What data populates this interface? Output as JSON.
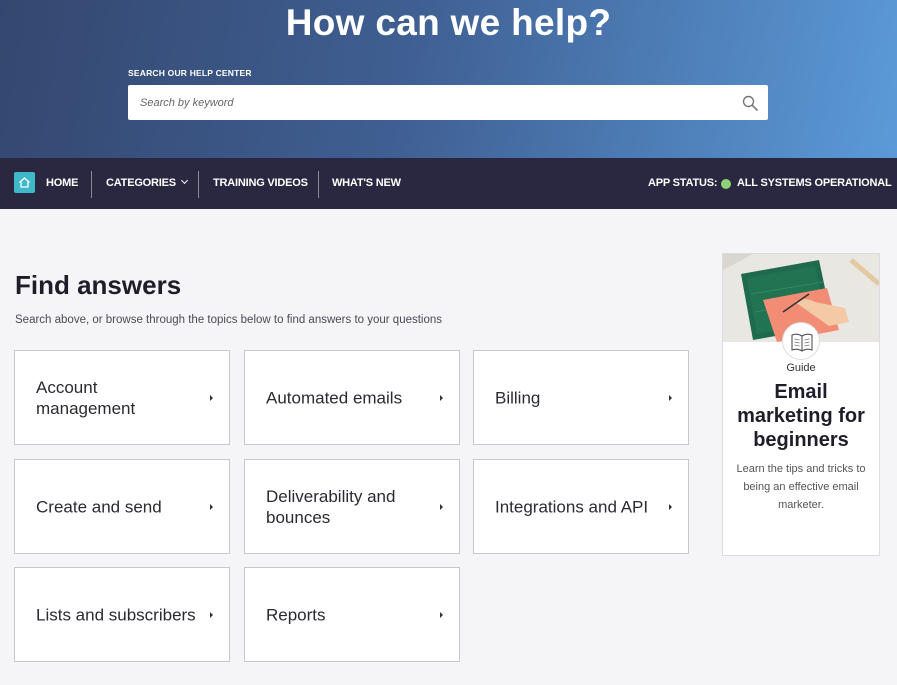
{
  "hero": {
    "title": "How can we help?",
    "search_label": "SEARCH OUR HELP CENTER",
    "search_placeholder": "Search by keyword",
    "search_value": ""
  },
  "nav": {
    "home": "HOME",
    "categories": "CATEGORIES",
    "training_videos": "TRAINING VIDEOS",
    "whats_new": "WHAT'S NEW",
    "status_label": "APP STATUS:",
    "status_text": "ALL SYSTEMS OPERATIONAL",
    "status_color": "#8fd174"
  },
  "main": {
    "title": "Find answers",
    "subtitle": "Search above, or browse through the topics below to find answers to your questions",
    "topics": [
      "Account management",
      "Automated emails",
      "Billing",
      "Create and send",
      "Deliverability and bounces",
      "Integrations and API",
      "Lists and subscribers",
      "Reports"
    ]
  },
  "guide": {
    "kicker": "Guide",
    "title": "Email marketing for beginners",
    "description": "Learn the tips and tricks to being an effective email marketer."
  },
  "colors": {
    "navbar": "#2a2740",
    "home_icon": "#3fb8c9",
    "hero_start": "#34476f",
    "hero_end": "#5b9ad8"
  }
}
